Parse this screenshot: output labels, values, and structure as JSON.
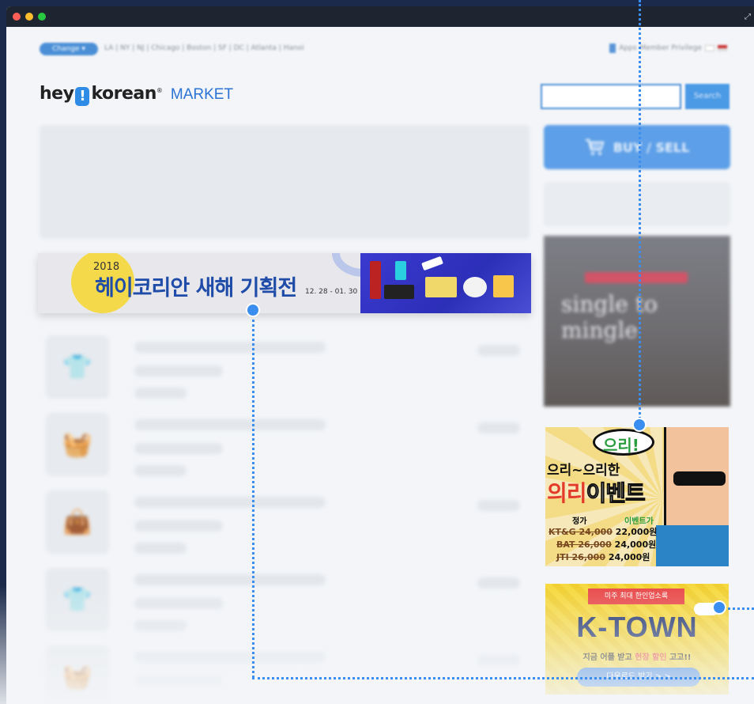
{
  "topnav": {
    "change_label": "Change",
    "cities": "LA | NY | NJ | Chicago | Boston | SF | DC | Atlanta | Hanoi",
    "apps_label": "Apps",
    "member_label": "Member Privilege"
  },
  "brand": {
    "hey": "hey",
    "bang": "!",
    "korean": "korean",
    "market": "MARKET"
  },
  "search": {
    "placeholder": "",
    "button_label": "Search"
  },
  "buysell_label": "BUY / SELL",
  "single_mingle": "single to mingle",
  "promo": {
    "year": "2018",
    "title": "헤이코리안 새해 기획전",
    "dates": "12. 28 - 01. 30"
  },
  "soju": {
    "bubble": "으리!",
    "line1": "으리~으리한",
    "line2a": "의리",
    "line2b": "이벤트",
    "regular": "정가",
    "event": "이벤트가",
    "rows": [
      {
        "brand": "KT&G 24,000",
        "price": "22,000원"
      },
      {
        "brand": "BAT 26,000",
        "price": "24,000원"
      },
      {
        "brand": "JTI 26,000",
        "price": "24,000원"
      }
    ]
  },
  "ktown": {
    "ribbon": "미주 최대 한인업소록",
    "title": "K-TOWN",
    "sub_pre": "지금 어플 받고 ",
    "sub_em": "현장 할인",
    "sub_post": " 고고!!",
    "download": "다운로드 받기 > >"
  },
  "colors": {
    "accent": "#3a8ef0",
    "frame": "#1b2a4a",
    "brand_blue": "#2a73d4"
  },
  "icons": {
    "traffic_lights": [
      "#ff5f57",
      "#febc2e",
      "#28c840"
    ]
  }
}
